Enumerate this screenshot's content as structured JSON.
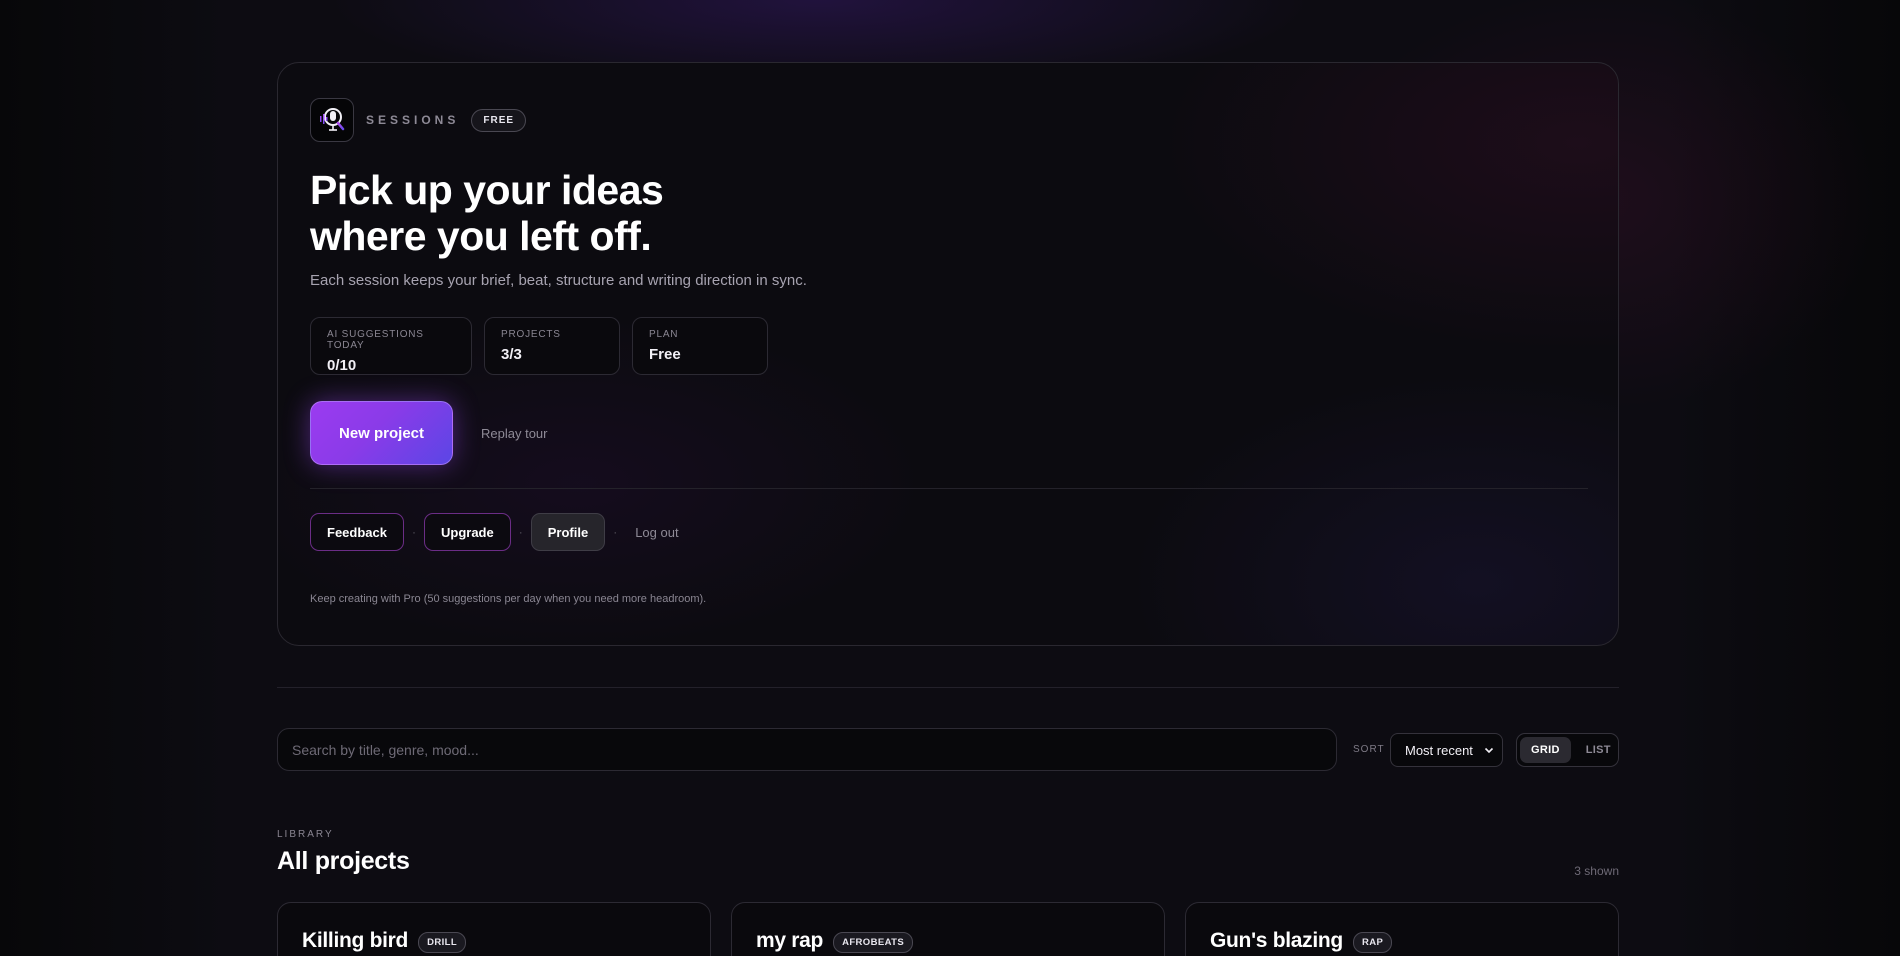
{
  "brand": {
    "name": "SESSIONS",
    "plan_badge": "FREE",
    "logo_icon": "microphone-logo-icon",
    "accent_color": "#9b3bf0"
  },
  "hero": {
    "headline_line1": "Pick up your ideas",
    "headline_line2": "where you left off.",
    "subtitle": "Each session keeps your brief, beat, structure and writing direction in sync.",
    "stats": [
      {
        "label": "AI SUGGESTIONS TODAY",
        "value": "0/10"
      },
      {
        "label": "PROJECTS",
        "value": "3/3"
      },
      {
        "label": "PLAN",
        "value": "Free"
      }
    ],
    "new_project_label": "New project",
    "replay_tour_label": "Replay tour",
    "nav": {
      "feedback": "Feedback",
      "upgrade": "Upgrade",
      "profile": "Profile",
      "logout": "Log out",
      "separator": "·"
    },
    "promo": "Keep creating with Pro (50 suggestions per day when you need more headroom)."
  },
  "toolbar": {
    "search_placeholder": "Search by title, genre, mood...",
    "sort_label": "SORT",
    "sort_value": "Most recent",
    "view_grid": "GRID",
    "view_list": "LIST",
    "active_view": "GRID"
  },
  "library": {
    "label": "LIBRARY",
    "title": "All projects",
    "shown_count": "3 shown",
    "projects": [
      {
        "title": "Killing bird",
        "genre": "DRILL"
      },
      {
        "title": "my rap",
        "genre": "AFROBEATS"
      },
      {
        "title": "Gun's blazing",
        "genre": "RAP"
      }
    ]
  }
}
